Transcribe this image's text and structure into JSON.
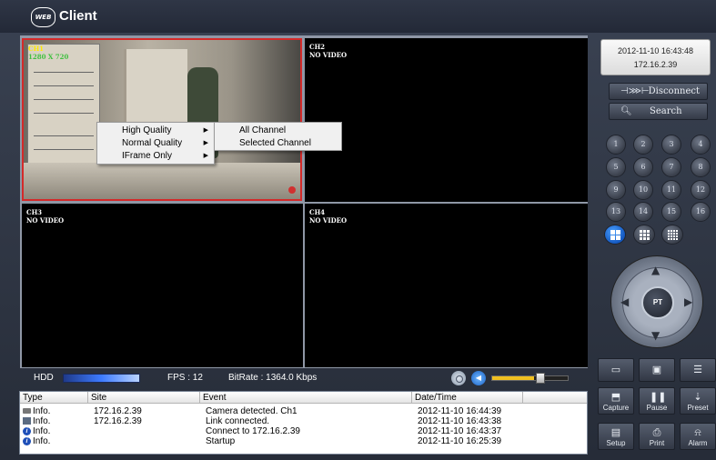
{
  "app": {
    "logo_text": "WEB",
    "title": "Client"
  },
  "channels": [
    {
      "name": "CH1",
      "resolution": "1280 X 720",
      "status": ""
    },
    {
      "name": "CH2",
      "status": "NO VIDEO"
    },
    {
      "name": "CH3",
      "status": "NO VIDEO"
    },
    {
      "name": "CH4",
      "status": "NO VIDEO"
    }
  ],
  "context_menu": {
    "items": [
      "High Quality",
      "Normal Quality",
      "IFrame Only"
    ],
    "submenu": [
      "All Channel",
      "Selected Channel"
    ]
  },
  "status_bar": {
    "hdd_label": "HDD",
    "fps_label": "FPS : 12",
    "bitrate_label": "BitRate : 1364.0 Kbps",
    "volume": 0.55
  },
  "log": {
    "columns": [
      "Type",
      "Site",
      "Event",
      "Date/Time"
    ],
    "rows": [
      {
        "type": "Info.",
        "site": "172.16.2.39",
        "event": "Camera detected. Ch1",
        "datetime": "2012-11-10 16:44:39"
      },
      {
        "type": "Info.",
        "site": "172.16.2.39",
        "event": "Link connected.",
        "datetime": "2012-11-10 16:43:38"
      },
      {
        "type": "Info.",
        "site": "",
        "event": "Connect to 172.16.2.39",
        "datetime": "2012-11-10 16:43:37"
      },
      {
        "type": "Info.",
        "site": "",
        "event": "Startup",
        "datetime": "2012-11-10 16:25:39"
      }
    ]
  },
  "panel": {
    "datetime": "2012-11-10 16:43:48",
    "ip": "172.16.2.39",
    "disconnect_label": "Disconnect",
    "search_label": "Search",
    "channel_buttons": [
      "1",
      "2",
      "3",
      "4",
      "5",
      "6",
      "7",
      "8",
      "9",
      "10",
      "11",
      "12",
      "13",
      "14",
      "15",
      "16"
    ],
    "ptz_label": "PT",
    "tools": {
      "capture": "Capture",
      "pause": "Pause",
      "preset": "Preset",
      "setup": "Setup",
      "print": "Print",
      "alarm": "Alarm"
    }
  },
  "colors": {
    "selected_border": "#d42a2a",
    "accent_blue": "#1458c0"
  }
}
